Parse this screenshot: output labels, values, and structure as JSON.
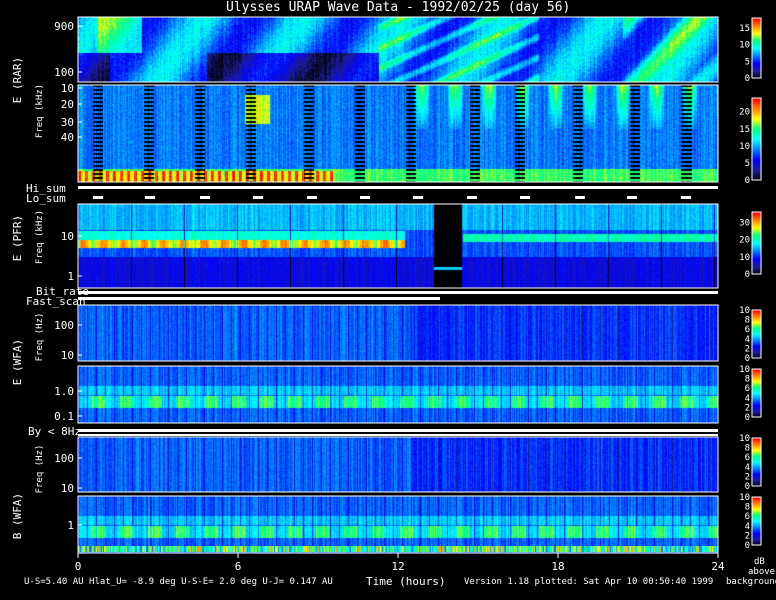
{
  "title": "Ulysses URAP Wave Data - 1992/02/25 (day 56)",
  "footer": {
    "left": "U-S=5.40 AU  Hlat_U= -8.9 deg  U-S-E= 2.0 deg  U-J= 0.147 AU",
    "xlabel": "Time (hours)",
    "right": "Version 1.18 plotted: Sat Apr 10 00:50:40 1999",
    "colorbar_unit": [
      "dB",
      "above",
      "background"
    ]
  },
  "bar_labels": {
    "hi_sum": "Hi_sum",
    "lo_sum": "Lo_sum",
    "bit_rate": "Bit_rate",
    "fast_scan": "Fast_scan",
    "by_lt_8hz": "By < 8Hz"
  },
  "axis_titles": {
    "rar": "E (RAR)",
    "pfr": "E (PFR)",
    "wfa_e": "E (WFA)",
    "wfa_b": "B (WFA)",
    "freq_unit": "Freq (kHz)",
    "freq_unit_hz": "Freq (Hz)"
  },
  "colors": {
    "background": "#000000",
    "text": "#ffffff",
    "colormap": [
      "#000000",
      "#1f1f9f",
      "#0000ff",
      "#0080ff",
      "#00ffff",
      "#00ff80",
      "#ffff00",
      "#ff8000",
      "#ff0000"
    ]
  },
  "chart_data": {
    "type": "heatmap",
    "x_ticks": [
      "0",
      "6",
      "12",
      "18",
      "24"
    ],
    "xlim": [
      0,
      24
    ],
    "panels": [
      {
        "id": "rar_high",
        "ylim": [
          60,
          900
        ],
        "yscale": "log",
        "y_ticks": [
          "100",
          "900"
        ],
        "cbar_ticks": [
          "15",
          "10",
          "5",
          "0"
        ],
        "cbar_range": [
          0,
          18
        ]
      },
      {
        "id": "rar_low",
        "ylim": [
          1,
          50
        ],
        "yscale": "linear",
        "y_ticks": [
          "40",
          "30",
          "20",
          "10"
        ],
        "cbar_ticks": [
          "20",
          "15",
          "10",
          "5",
          "0"
        ],
        "cbar_range": [
          0,
          24
        ]
      },
      {
        "id": "pfr",
        "ylim": [
          0.6,
          30
        ],
        "yscale": "log",
        "y_ticks": [
          "10",
          "1"
        ],
        "cbar_ticks": [
          "30",
          "20",
          "10",
          "0"
        ],
        "cbar_range": [
          0,
          36
        ]
      },
      {
        "id": "wfa_e_high",
        "ylim": [
          8,
          400
        ],
        "yscale": "log",
        "y_ticks": [
          "100",
          "10"
        ],
        "cbar_ticks": [
          "10",
          "8",
          "6",
          "4",
          "2",
          "0"
        ],
        "cbar_range": [
          0,
          10
        ]
      },
      {
        "id": "wfa_e_low",
        "ylim": [
          0.08,
          4
        ],
        "yscale": "log",
        "y_ticks": [
          "1.0",
          "0.1"
        ],
        "cbar_ticks": [
          "10",
          "8",
          "6",
          "4",
          "2",
          "0"
        ],
        "cbar_range": [
          0,
          10
        ]
      },
      {
        "id": "wfa_b_high",
        "ylim": [
          8,
          400
        ],
        "yscale": "log",
        "y_ticks": [
          "100",
          "10"
        ],
        "cbar_ticks": [
          "10",
          "8",
          "6",
          "4",
          "2",
          "0"
        ],
        "cbar_range": [
          0,
          10
        ]
      },
      {
        "id": "wfa_b_low",
        "ylim": [
          0.08,
          4
        ],
        "yscale": "log",
        "y_ticks": [
          "1"
        ],
        "cbar_ticks": [
          "10",
          "8",
          "6",
          "4",
          "2",
          "0"
        ],
        "cbar_range": [
          0,
          10
        ]
      }
    ]
  }
}
